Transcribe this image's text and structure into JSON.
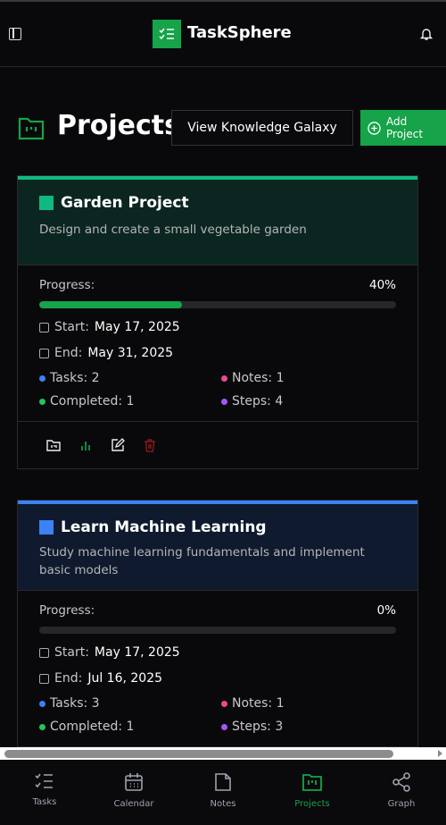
{
  "app": {
    "name": "TaskSphere"
  },
  "page": {
    "title": "Projects",
    "galaxy_button": "View Knowledge Galaxy",
    "add_button": "Add Project"
  },
  "projects": [
    {
      "name": "Garden Project",
      "description": "Design and create a small vegetable garden",
      "progress_label": "Progress:",
      "progress": "40%",
      "progress_value": 40,
      "start_label": "Start:",
      "start": "May 17, 2025",
      "end_label": "End:",
      "end": "May 31, 2025",
      "tasks": "Tasks: 2",
      "notes": "Notes: 1",
      "completed": "Completed: 1",
      "steps": "Steps: 4",
      "color": "#10b981"
    },
    {
      "name": "Learn Machine Learning",
      "description": "Study machine learning fundamentals and implement basic models",
      "progress_label": "Progress:",
      "progress": "0%",
      "progress_value": 0,
      "start_label": "Start:",
      "start": "May 17, 2025",
      "end_label": "End:",
      "end": "Jul 16, 2025",
      "tasks": "Tasks: 3",
      "notes": "Notes: 1",
      "completed": "Completed: 1",
      "steps": "Steps: 3",
      "color": "#3b82f6"
    }
  ],
  "nav": [
    {
      "label": "Tasks"
    },
    {
      "label": "Calendar"
    },
    {
      "label": "Notes"
    },
    {
      "label": "Projects"
    },
    {
      "label": "Graph"
    }
  ]
}
